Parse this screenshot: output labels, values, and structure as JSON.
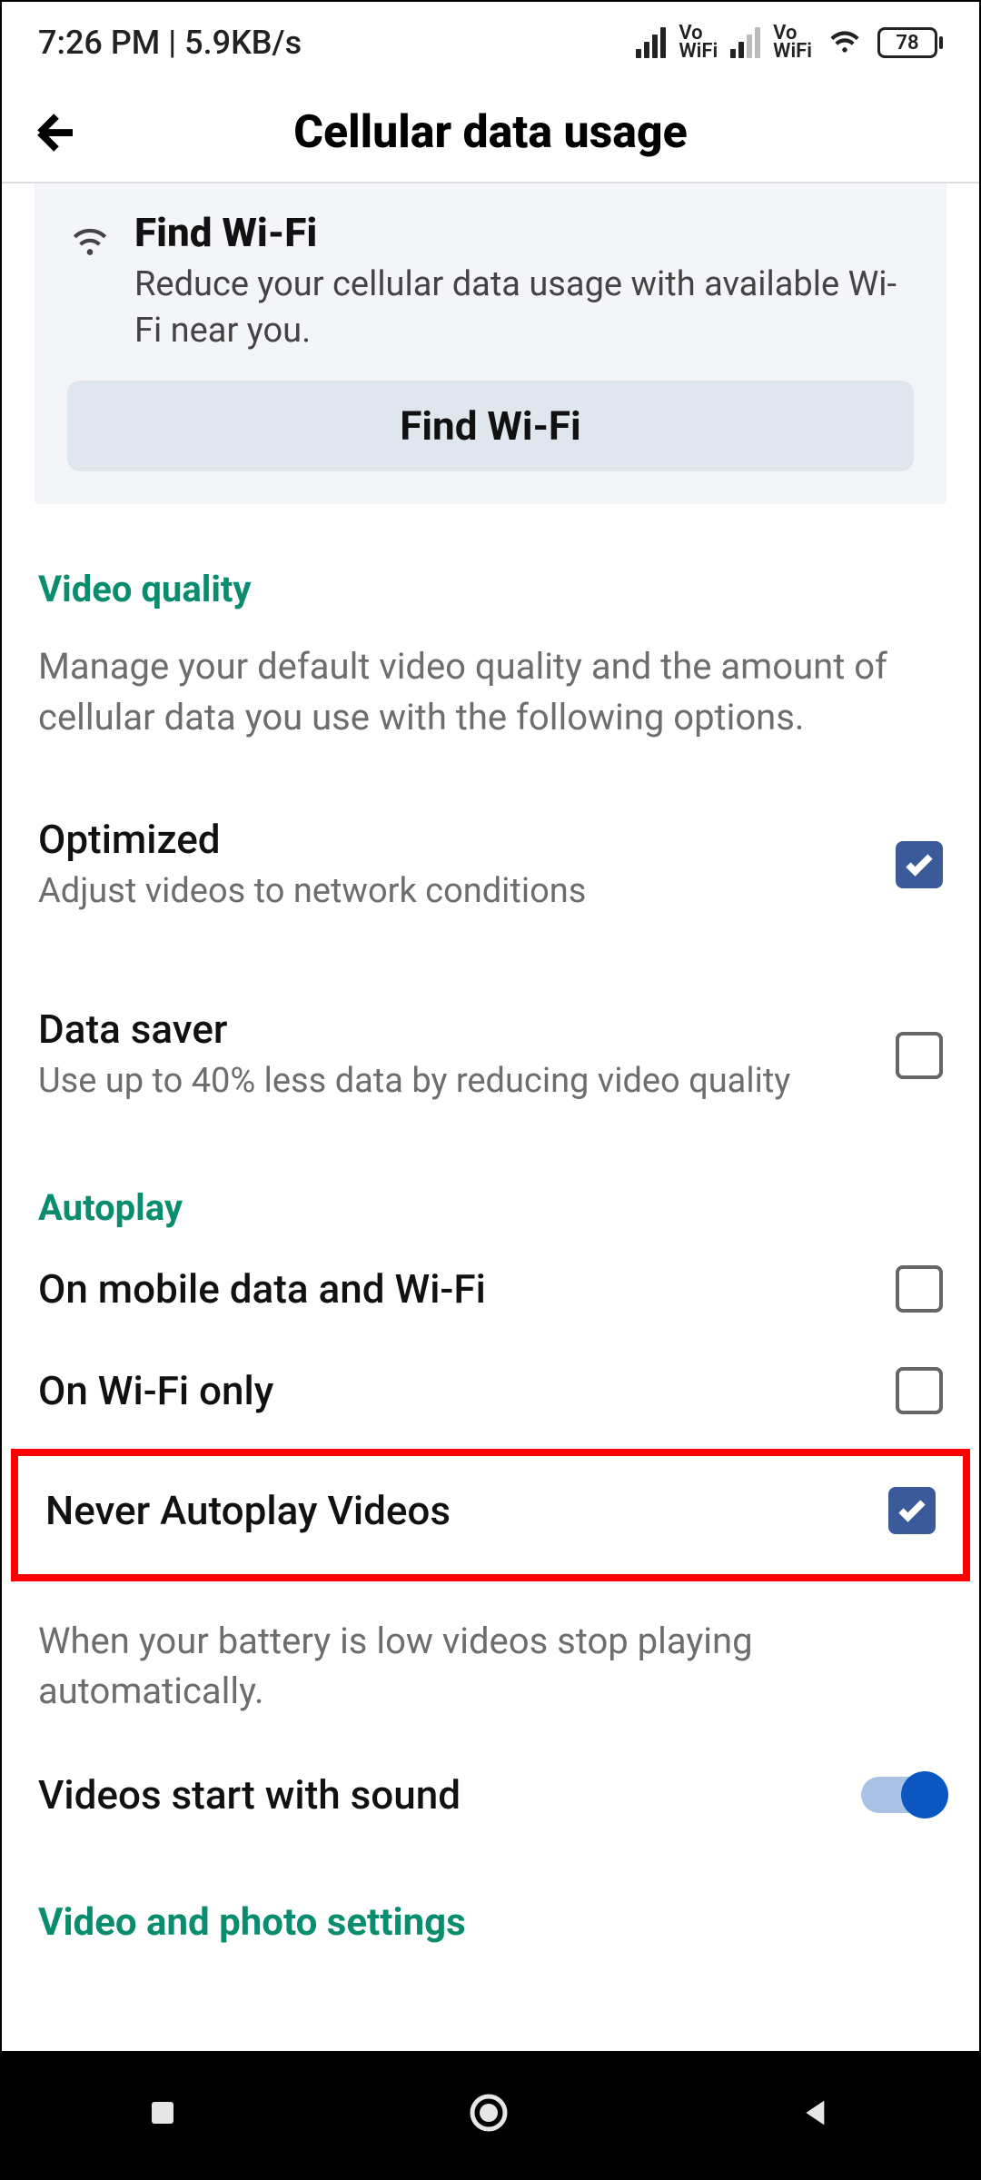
{
  "status": {
    "time": "7:26 PM",
    "speed": "5.9KB/s",
    "vowifi": "Vo\nWiFi",
    "battery": "78"
  },
  "header": {
    "title": "Cellular data usage"
  },
  "wifi_card": {
    "title": "Find Wi-Fi",
    "subtitle": "Reduce your cellular data usage with available Wi-Fi near you.",
    "button": "Find Wi-Fi"
  },
  "video_quality": {
    "header": "Video quality",
    "sub": "Manage your default video quality and the amount of cellular data you use with the following options.",
    "optimized_title": "Optimized",
    "optimized_sub": "Adjust videos to network conditions",
    "datasaver_title": "Data saver",
    "datasaver_sub": "Use up to 40% less data by reducing video quality"
  },
  "autoplay": {
    "header": "Autoplay",
    "opt1": "On mobile data and Wi-Fi",
    "opt2": "On Wi-Fi only",
    "opt3": "Never Autoplay Videos",
    "note": "When your battery is low videos stop playing automatically."
  },
  "sound": {
    "title": "Videos start with sound"
  },
  "link": {
    "label": "Video and photo settings"
  }
}
